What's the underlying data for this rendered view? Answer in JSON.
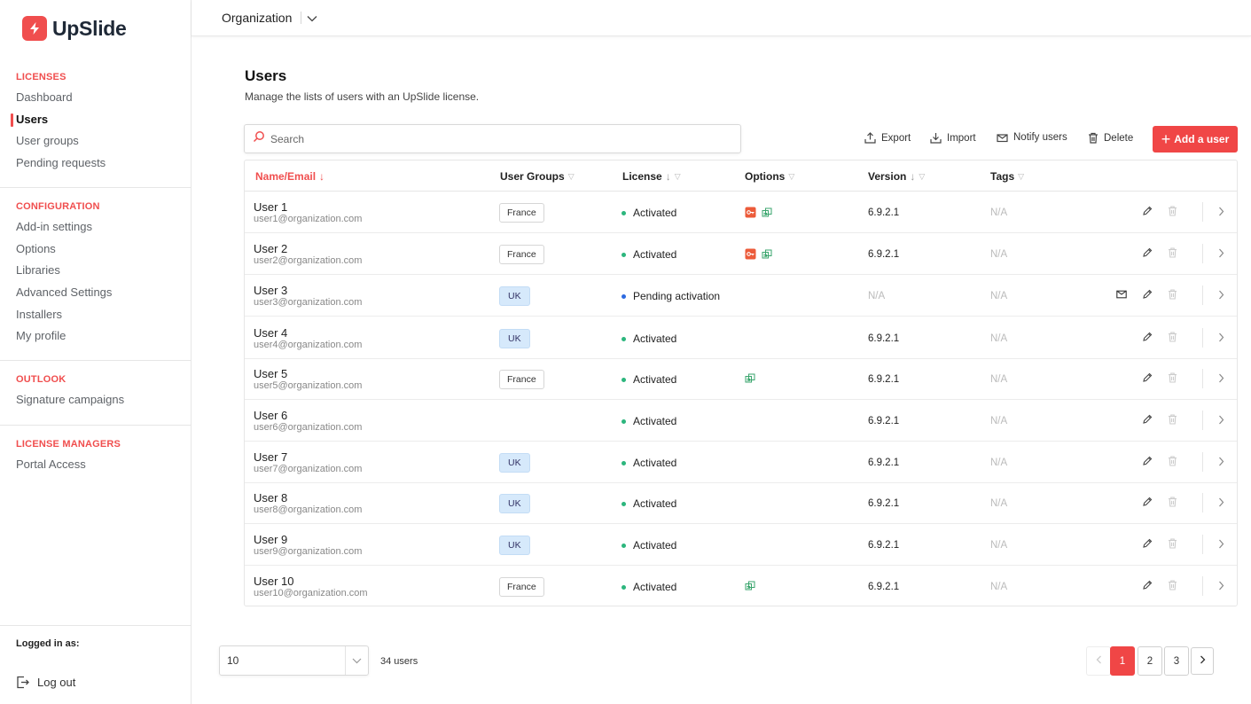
{
  "brand": {
    "name": "UpSlide",
    "color": "#f04e4e"
  },
  "sidebar": {
    "sections": [
      {
        "heading": "LICENSES",
        "items": [
          "Dashboard",
          "Users",
          "User groups",
          "Pending requests"
        ]
      },
      {
        "heading": "CONFIGURATION",
        "items": [
          "Add-in settings",
          "Options",
          "Libraries",
          "Advanced Settings",
          "Installers",
          "My profile"
        ]
      },
      {
        "heading": "OUTLOOK",
        "items": [
          "Signature campaigns"
        ]
      },
      {
        "heading": "LICENSE MANAGERS",
        "items": [
          "Portal Access"
        ]
      }
    ],
    "active_item": "Users",
    "logged_in_label": "Logged in as:",
    "logout_label": "Log out"
  },
  "topbar": {
    "organization": "Organization",
    "icon": "chevron-down-icon"
  },
  "page": {
    "title": "Users",
    "subtitle": "Manage the lists of users with an UpSlide license."
  },
  "toolbar": {
    "search_placeholder": "Search",
    "export_label": "Export",
    "import_label": "Import",
    "notify_label": "Notify users",
    "delete_label": "Delete",
    "add_label": "Add a user"
  },
  "table": {
    "columns": [
      "Name/Email",
      "User Groups",
      "License",
      "Options",
      "Version",
      "Tags"
    ],
    "sorted_column": "Name/Email",
    "rows": [
      {
        "name": "User 1",
        "email": "user1@organization.com",
        "group": "France",
        "license": "Activated",
        "status": "active",
        "options": [
          "key-icon",
          "addin-icon"
        ],
        "version": "6.9.2.1",
        "tags": "N/A"
      },
      {
        "name": "User 2",
        "email": "user2@organization.com",
        "group": "France",
        "license": "Activated",
        "status": "active",
        "options": [
          "key-icon",
          "addin-icon"
        ],
        "version": "6.9.2.1",
        "tags": "N/A"
      },
      {
        "name": "User 3",
        "email": "user3@organization.com",
        "group": "UK",
        "license": "Pending activation",
        "status": "pending",
        "options": [],
        "version": "N/A",
        "tags": "N/A"
      },
      {
        "name": "User 4",
        "email": "user4@organization.com",
        "group": "UK",
        "license": "Activated",
        "status": "active",
        "options": [],
        "version": "6.9.2.1",
        "tags": "N/A"
      },
      {
        "name": "User 5",
        "email": "user5@organization.com",
        "group": "France",
        "license": "Activated",
        "status": "active",
        "options": [
          "addin-icon"
        ],
        "version": "6.9.2.1",
        "tags": "N/A"
      },
      {
        "name": "User 6",
        "email": "user6@organization.com",
        "group": "",
        "license": "Activated",
        "status": "active",
        "options": [],
        "version": "6.9.2.1",
        "tags": "N/A"
      },
      {
        "name": "User 7",
        "email": "user7@organization.com",
        "group": "UK",
        "license": "Activated",
        "status": "active",
        "options": [],
        "version": "6.9.2.1",
        "tags": "N/A"
      },
      {
        "name": "User 8",
        "email": "user8@organization.com",
        "group": "UK",
        "license": "Activated",
        "status": "active",
        "options": [],
        "version": "6.9.2.1",
        "tags": "N/A"
      },
      {
        "name": "User 9",
        "email": "user9@organization.com",
        "group": "UK",
        "license": "Activated",
        "status": "active",
        "options": [],
        "version": "6.9.2.1",
        "tags": "N/A"
      },
      {
        "name": "User 10",
        "email": "user10@organization.com",
        "group": "France",
        "license": "Activated",
        "status": "active",
        "options": [
          "addin-icon"
        ],
        "version": "6.9.2.1",
        "tags": "N/A"
      }
    ]
  },
  "footer": {
    "per_page": "10",
    "total": "34 users",
    "pages": [
      "1",
      "2",
      "3"
    ],
    "current_page": "1"
  },
  "colors": {
    "accent": "#f04646",
    "active_dot": "#2cb67d",
    "pending_dot": "#2d6ae0",
    "uk_tag": "#d6e9fb"
  }
}
